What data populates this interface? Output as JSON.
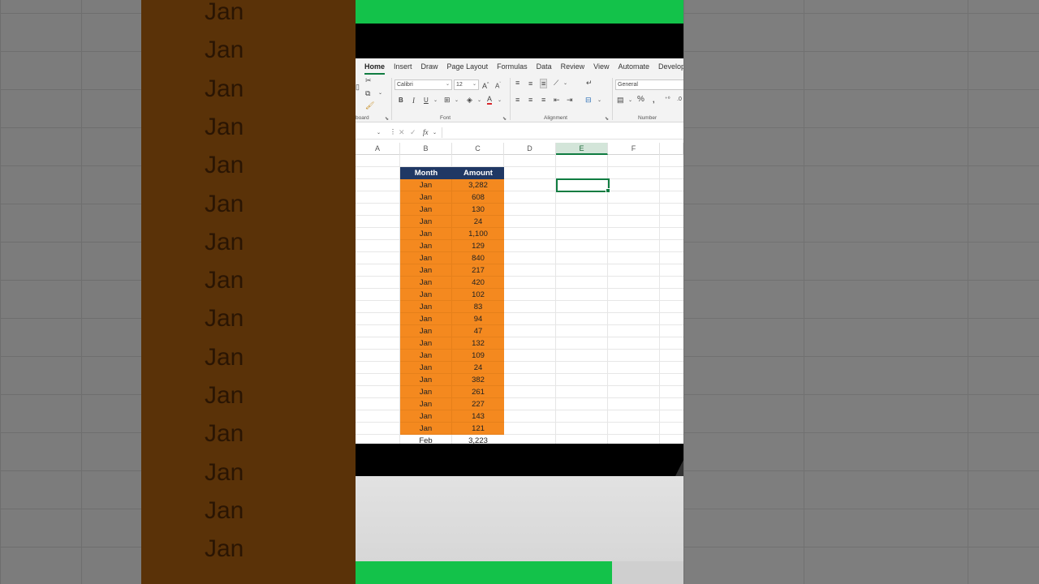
{
  "background": {
    "jan_label": "Jan",
    "jan_count": 15
  },
  "ribbon": {
    "tabs": [
      "Home",
      "Insert",
      "Draw",
      "Page Layout",
      "Formulas",
      "Data",
      "Review",
      "View",
      "Automate",
      "Develope"
    ],
    "active_tab": "Home",
    "groups": {
      "clipboard": "board",
      "font": "Font",
      "alignment": "Alignment",
      "number": "Number"
    },
    "font_name": "Calibri",
    "font_size": "12",
    "number_format": "General"
  },
  "formula_bar": {
    "fx_label": "fx",
    "value": ""
  },
  "columns": [
    "A",
    "B",
    "C",
    "D",
    "E",
    "F"
  ],
  "selected_column": "E",
  "table": {
    "headers": [
      "Month",
      "Amount"
    ],
    "rows": [
      [
        "Jan",
        "3,282"
      ],
      [
        "Jan",
        "608"
      ],
      [
        "Jan",
        "130"
      ],
      [
        "Jan",
        "24"
      ],
      [
        "Jan",
        "1,100"
      ],
      [
        "Jan",
        "129"
      ],
      [
        "Jan",
        "840"
      ],
      [
        "Jan",
        "217"
      ],
      [
        "Jan",
        "420"
      ],
      [
        "Jan",
        "102"
      ],
      [
        "Jan",
        "83"
      ],
      [
        "Jan",
        "94"
      ],
      [
        "Jan",
        "47"
      ],
      [
        "Jan",
        "132"
      ],
      [
        "Jan",
        "109"
      ],
      [
        "Jan",
        "24"
      ],
      [
        "Jan",
        "382"
      ],
      [
        "Jan",
        "261"
      ],
      [
        "Jan",
        "227"
      ],
      [
        "Jan",
        "143"
      ],
      [
        "Jan",
        "121"
      ]
    ],
    "extra_row": [
      "Feb",
      "3,223"
    ]
  },
  "colors": {
    "header_fill": "#203864",
    "row_fill": "#f4891f",
    "accent_green": "#107c41",
    "frame_green": "#13c24a"
  }
}
